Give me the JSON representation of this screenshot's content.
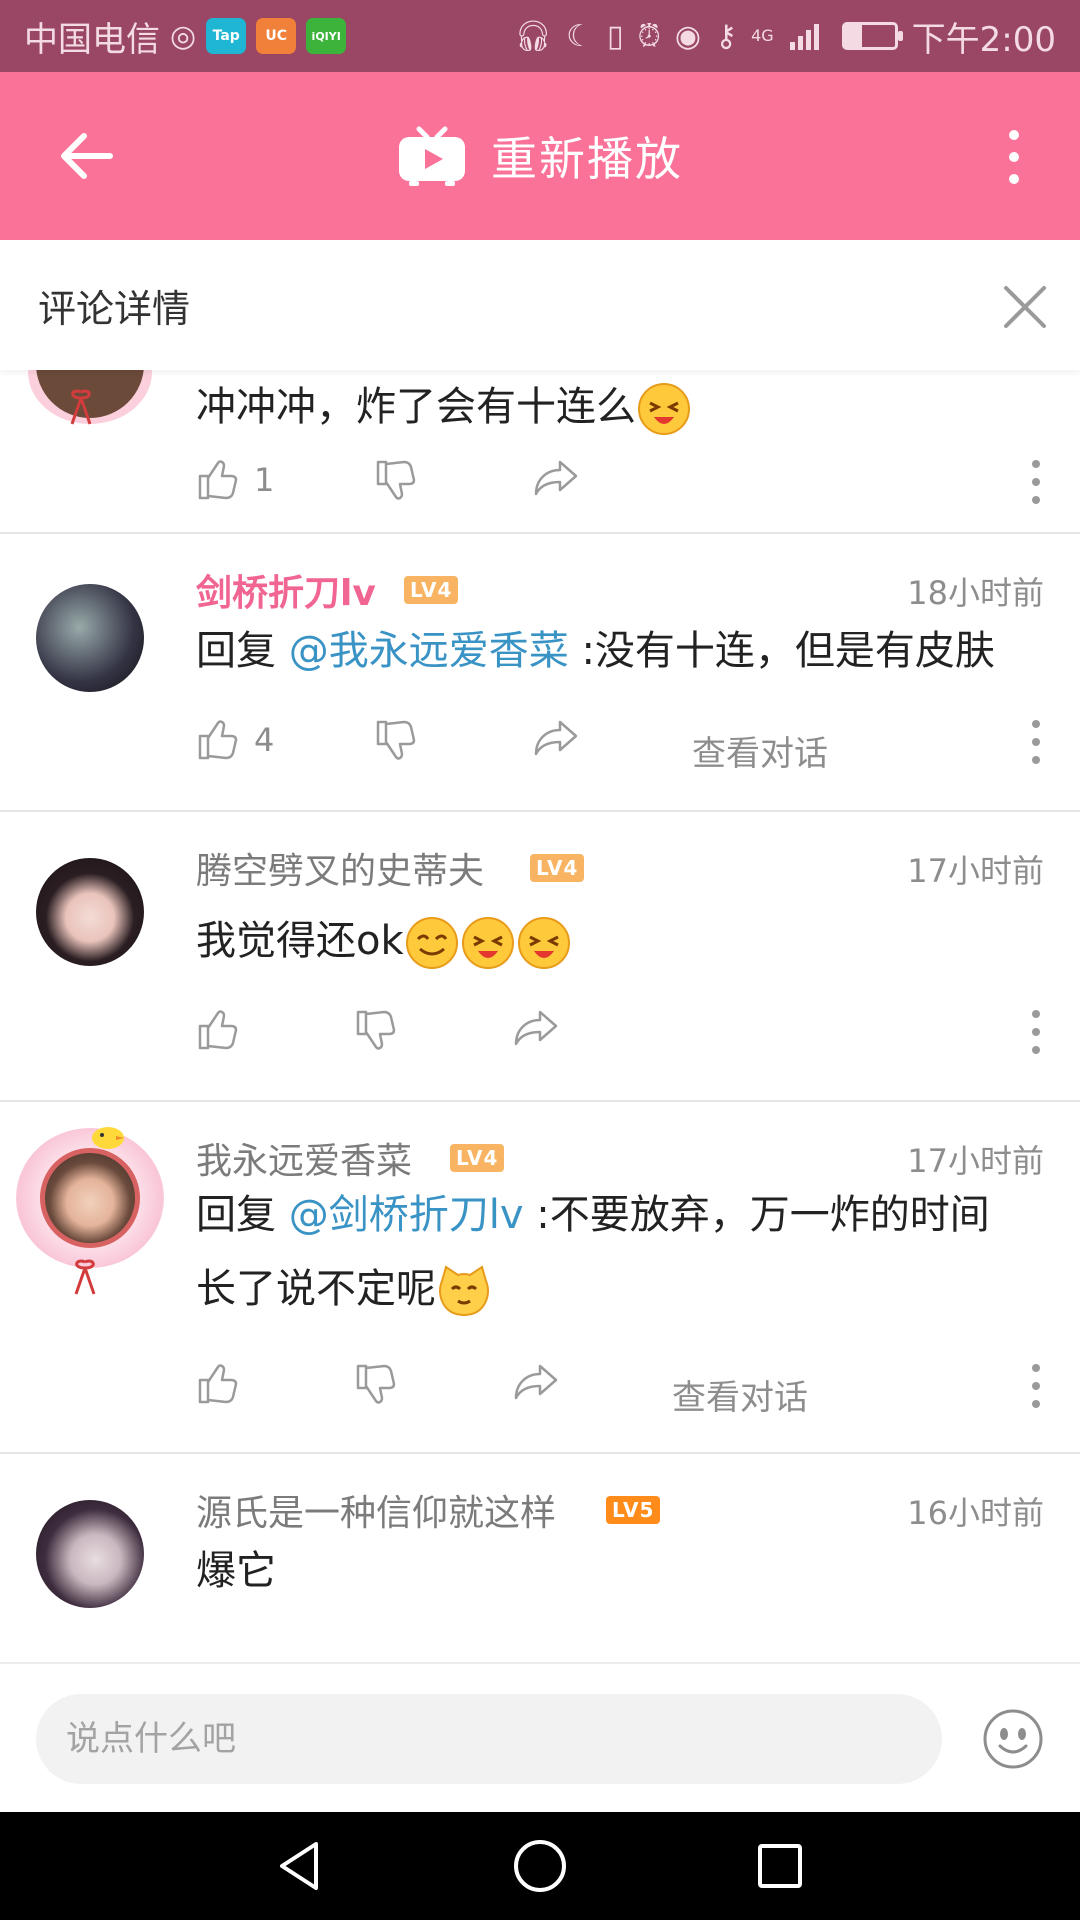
{
  "status_bar": {
    "carrier": "中国电信",
    "apps": [
      "Tap",
      "UC",
      "iQIYI"
    ],
    "signal": "4G",
    "time": "下午2:00"
  },
  "title_bar": {
    "title": "重新播放"
  },
  "detail_header": {
    "title": "评论详情"
  },
  "comments": [
    {
      "text": "冲冲冲，炸了会有十连么",
      "likes": "1"
    },
    {
      "username": "剑桥折刀lv",
      "level": "LV4",
      "time": "18小时前",
      "reply_prefix": "回复",
      "mention": "@我永远爱香菜",
      "text": ":没有十连，但是有皮肤",
      "likes": "4",
      "view_conversation": "查看对话"
    },
    {
      "username": "腾空劈叉的史蒂夫",
      "level": "LV4",
      "time": "17小时前",
      "text": "我觉得还ok"
    },
    {
      "username": "我永远爱香菜",
      "level": "LV4",
      "time": "17小时前",
      "reply_prefix": "回复",
      "mention": "@剑桥折刀lv",
      "text_line1": ":不要放弃，万一炸的时间",
      "text_line2": "长了说不定呢",
      "view_conversation": "查看对话"
    },
    {
      "username": "源氏是一种信仰就这样",
      "level": "LV5",
      "time": "16小时前",
      "text": "爆它"
    }
  ],
  "input": {
    "placeholder": "说点什么吧"
  },
  "colors": {
    "brand_pink": "#fb7299",
    "status_bar": "#9a4766",
    "mention_blue": "#3a93c5",
    "username_pink": "#f06591",
    "level4": "#f8b462",
    "level5": "#ff8c1a"
  },
  "icons": [
    "back-arrow-icon",
    "tv-play-icon",
    "more-vertical-icon",
    "close-icon",
    "thumbs-up-icon",
    "thumbs-down-icon",
    "share-icon",
    "emoji-icon",
    "nav-back-icon",
    "nav-home-icon",
    "nav-recent-icon"
  ]
}
